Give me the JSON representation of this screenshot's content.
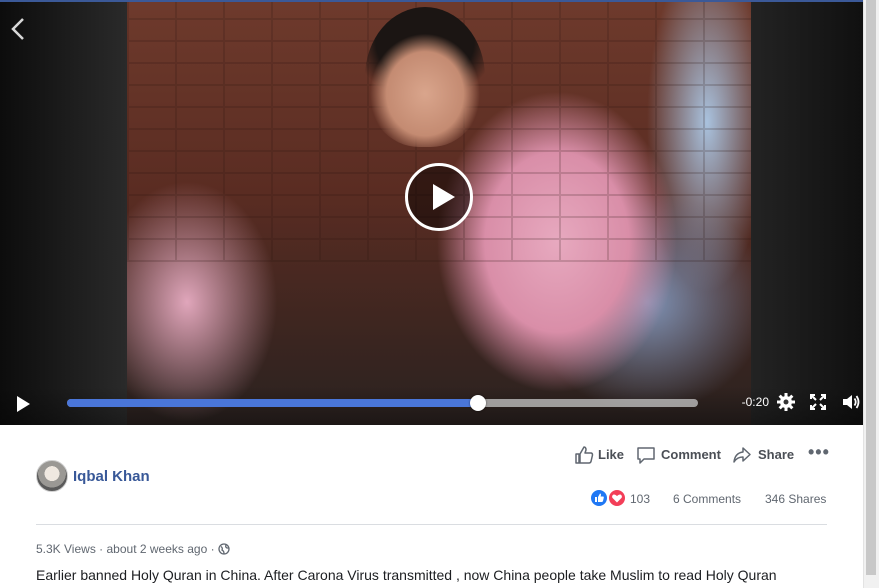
{
  "video": {
    "time_remaining": "-0:20",
    "progress_fraction": 0.652
  },
  "actions": {
    "like_label": "Like",
    "comment_label": "Comment",
    "share_label": "Share"
  },
  "post": {
    "author": "Iqbal Khan",
    "reaction_count": "103",
    "comments_count": "6 Comments",
    "shares_count": "346 Shares",
    "views": "5.3K Views",
    "separator": "·",
    "time_ago": "about 2 weeks ago",
    "description": "Earlier banned Holy Quran in China. After Carona Virus transmitted , now China people take Muslim to read Holy Quran"
  },
  "colors": {
    "progress_fill": "#4a76d9",
    "author_link": "#385898",
    "like_reaction": "#2078f4",
    "love_reaction": "#f33e58"
  }
}
